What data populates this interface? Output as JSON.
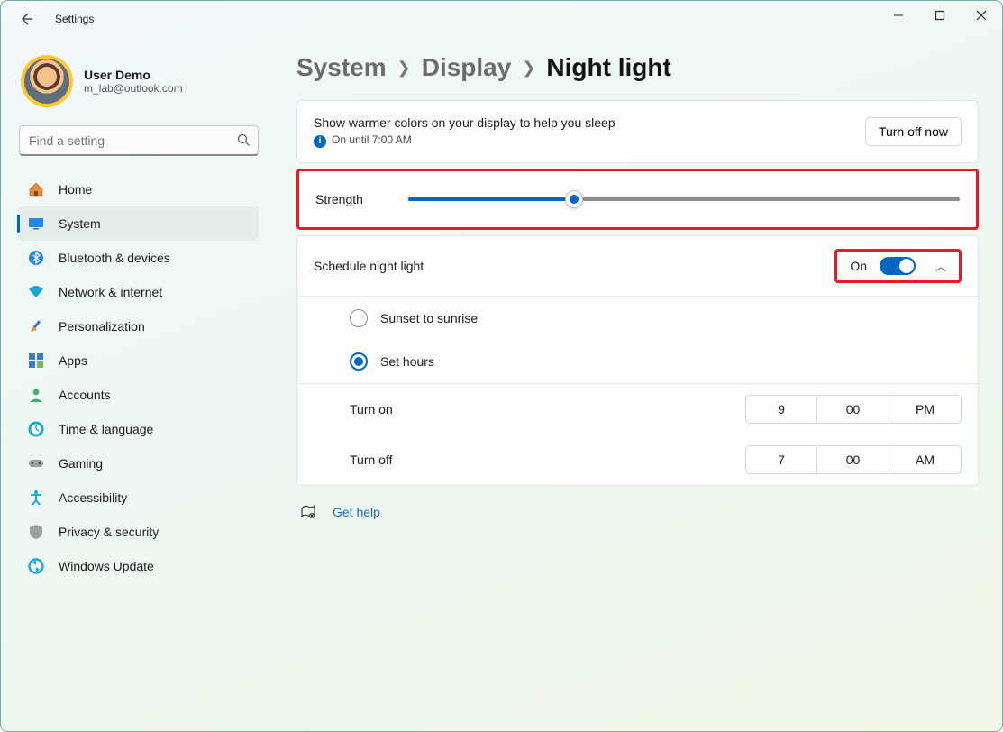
{
  "window": {
    "title": "Settings"
  },
  "profile": {
    "name": "User Demo",
    "email": "m_lab@outlook.com"
  },
  "search": {
    "placeholder": "Find a setting"
  },
  "sidebar": {
    "items": [
      {
        "label": "Home"
      },
      {
        "label": "System"
      },
      {
        "label": "Bluetooth & devices"
      },
      {
        "label": "Network & internet"
      },
      {
        "label": "Personalization"
      },
      {
        "label": "Apps"
      },
      {
        "label": "Accounts"
      },
      {
        "label": "Time & language"
      },
      {
        "label": "Gaming"
      },
      {
        "label": "Accessibility"
      },
      {
        "label": "Privacy & security"
      },
      {
        "label": "Windows Update"
      }
    ]
  },
  "breadcrumbs": {
    "a": "System",
    "b": "Display",
    "c": "Night light"
  },
  "master": {
    "desc": "Show warmer colors on your display to help you sleep",
    "status": "On until 7:00 AM",
    "button": "Turn off now"
  },
  "strength": {
    "label": "Strength",
    "value_percent": 30
  },
  "schedule": {
    "label": "Schedule night light",
    "state": "On",
    "opt_sunset": "Sunset to sunrise",
    "opt_hours": "Set hours",
    "turn_on_label": "Turn on",
    "turn_off_label": "Turn off",
    "on_hour": "9",
    "on_min": "00",
    "on_ampm": "PM",
    "off_hour": "7",
    "off_min": "00",
    "off_ampm": "AM"
  },
  "help": {
    "label": "Get help"
  }
}
